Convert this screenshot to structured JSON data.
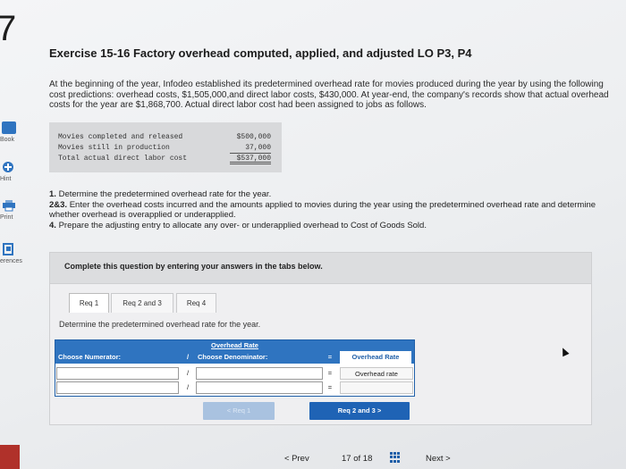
{
  "question_number": "7",
  "sidebar": {
    "items": [
      {
        "label": "Book",
        "icon": "book-icon"
      },
      {
        "label": "Hint",
        "icon": "hint-icon"
      },
      {
        "label": "Print",
        "icon": "print-icon"
      },
      {
        "label": "erences",
        "icon": "references-icon"
      }
    ]
  },
  "exercise": {
    "title": "Exercise 15-16 Factory overhead computed, applied, and adjusted LO P3, P4",
    "intro": "At the beginning of the year, Infodeo established its predetermined overhead rate for movies produced during the year by using the following cost predictions: overhead costs, $1,505,000,and direct labor costs, $430,000. At year-end, the company's records show that actual overhead costs for the year are $1,868,700. Actual direct labor cost had been assigned to jobs as follows."
  },
  "cost_table": {
    "rows": [
      {
        "label": "Movies completed and released",
        "value": "$500,000"
      },
      {
        "label": "Movies still in production",
        "value": "37,000"
      },
      {
        "label": "Total actual direct labor cost",
        "value": "$537,000"
      }
    ]
  },
  "questions": [
    {
      "num": "1.",
      "text": "Determine the predetermined overhead rate for the year."
    },
    {
      "num": "2&3.",
      "text": "Enter the overhead costs incurred and the amounts applied to movies during the year using the predetermined overhead rate and determine whether overhead is overapplied or underapplied."
    },
    {
      "num": "4.",
      "text": "Prepare the adjusting entry to allocate any over- or underapplied overhead to Cost of Goods Sold."
    }
  ],
  "complete_prompt": "Complete this question by entering your answers in the tabs below.",
  "tabs": [
    "Req 1",
    "Req 2 and 3",
    "Req 4"
  ],
  "instruction": "Determine the predetermined overhead rate for the year.",
  "rate_table": {
    "heading": "Overhead Rate",
    "col_numerator": "Choose Numerator:",
    "div_symbol": "/",
    "col_denominator": "Choose Denominator:",
    "eq_symbol": "=",
    "col_result": "Overhead Rate",
    "result_row_label": "Overhead rate"
  },
  "nav_buttons": {
    "prev": "< Req 1",
    "next": "Req 2 and 3  >"
  },
  "footer": {
    "prev": "< Prev",
    "page_current": "17",
    "page_of": "of",
    "page_total": "18",
    "next": "Next >"
  },
  "colors": {
    "accent_blue": "#2f74c0",
    "button_blue": "#1f63b5"
  }
}
